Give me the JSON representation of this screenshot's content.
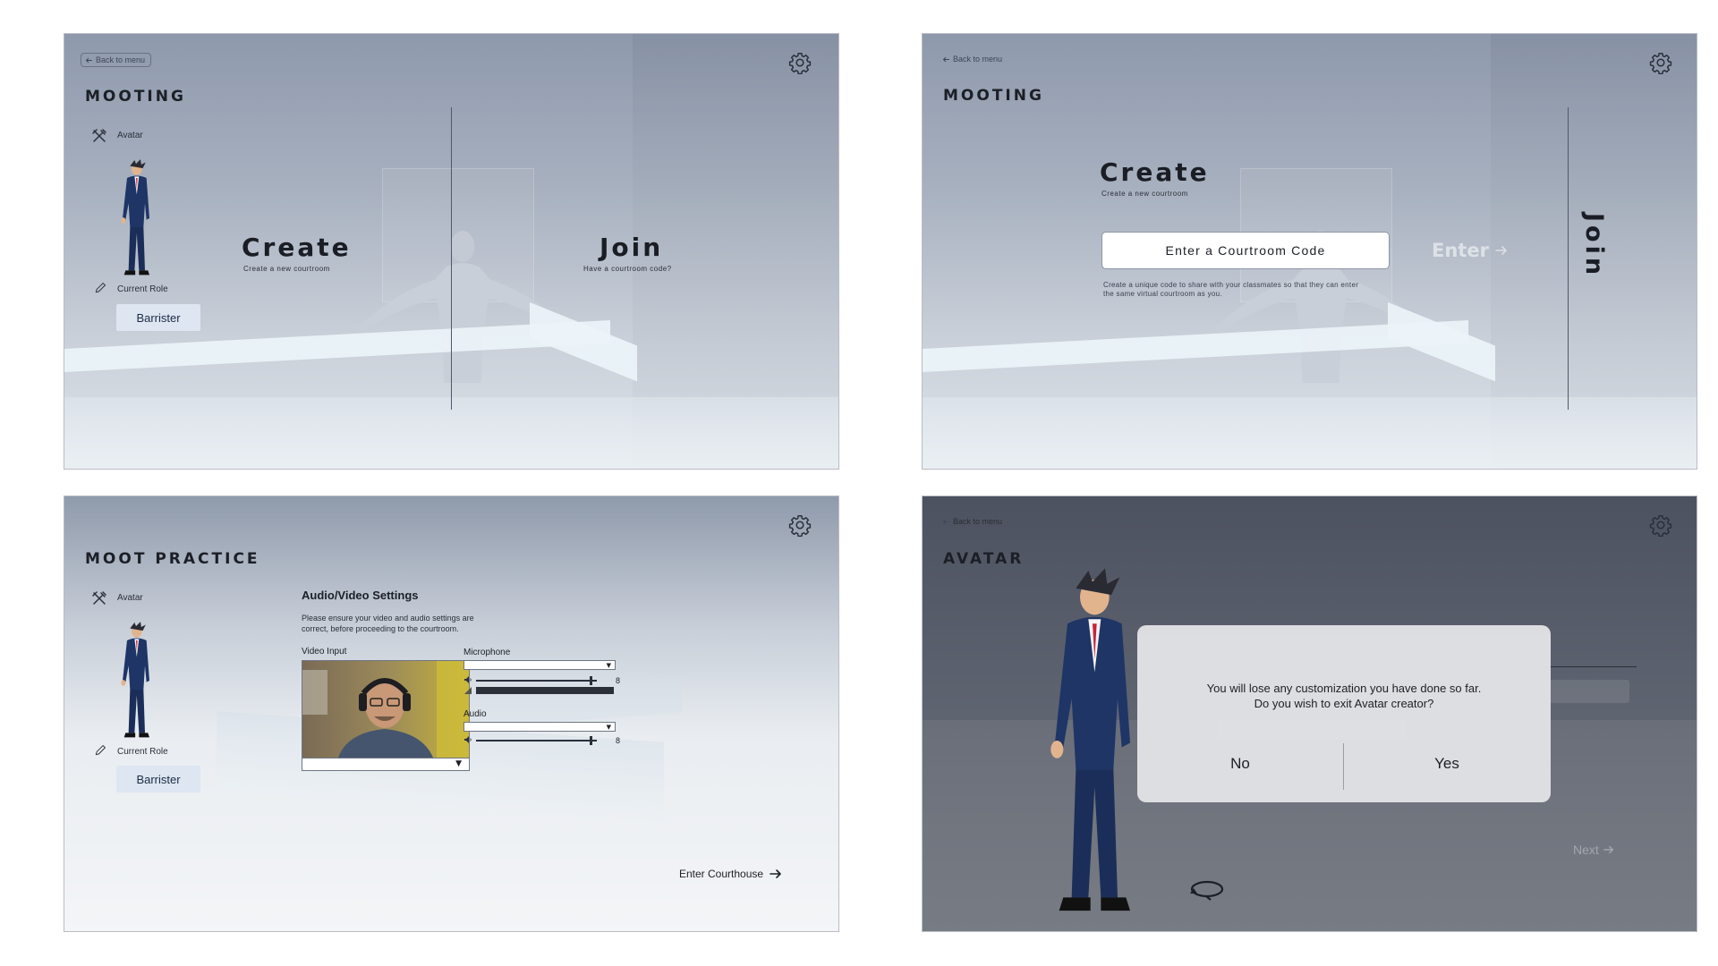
{
  "common": {
    "back_label": "Back to menu",
    "avatar_label": "Avatar",
    "current_role_label": "Current Role",
    "role_value": "Barrister"
  },
  "screen1": {
    "title": "MOOTING",
    "create_title": "Create",
    "create_subtitle": "Create a new courtroom",
    "join_title": "Join",
    "join_subtitle": "Have a courtroom code?"
  },
  "screen2": {
    "title": "MOOTING",
    "create_title": "Create",
    "create_subtitle": "Create a new courtroom",
    "code_placeholder": "Enter a Courtroom Code",
    "enter_label": "Enter",
    "hint_line1": "Create a unique code to share with your classmates so that they can enter",
    "hint_line2": "the same virtual courtroom as you.",
    "join_title": "Join"
  },
  "screen3": {
    "title": "MOOT PRACTICE",
    "av_title": "Audio/Video Settings",
    "av_desc_line1": "Please ensure your video and audio settings are",
    "av_desc_line2": "correct, before proceeding to the courtroom.",
    "video_label": "Video Input",
    "mic_label": "Microphone",
    "mic_volume": "8",
    "mic_volume_fraction": 0.95,
    "audio_label": "Audio",
    "audio_volume": "8",
    "audio_volume_fraction": 0.95,
    "enter_label": "Enter Courthouse"
  },
  "screen4": {
    "title": "AVATAR",
    "dialog_line1": "You will lose any customization you have done so far.",
    "dialog_line2": "Do you wish to exit Avatar creator?",
    "no_label": "No",
    "yes_label": "Yes",
    "next_label": "Next"
  },
  "icons": {
    "gear": "gear-icon",
    "back_arrow": "arrow-left-icon",
    "avatar_tools": "tools-icon",
    "pencil": "pencil-icon",
    "rotate": "rotate-icon",
    "speaker": "speaker-icon"
  },
  "colors": {
    "role_button_bg": "#dde6f1",
    "dark_overlay": "#5d626f",
    "suit_blue": "#1e3566"
  }
}
